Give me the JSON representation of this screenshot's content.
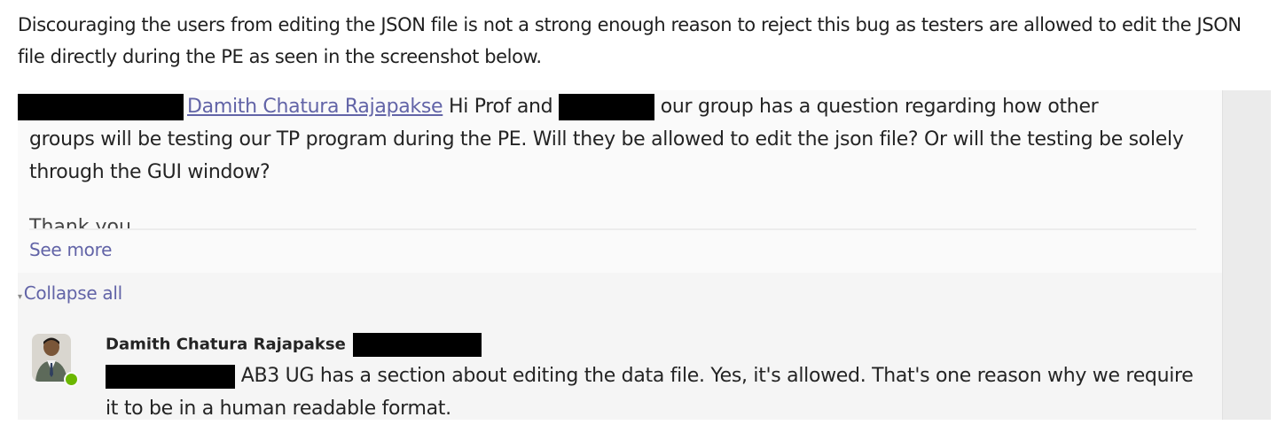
{
  "intro": {
    "text": "Discouraging the users from editing the JSON file is not a strong enough reason to reject this bug as testers are allowed to edit the JSON file directly during the PE as seen in the screenshot below."
  },
  "message": {
    "mention": "Damith Chatura Rajapakse",
    "text_after_mention": " Hi Prof and ",
    "text_after_redaction": " our group has a question regarding how other",
    "text_rest": "groups will be testing our TP program during the PE. Will they be allowed to edit the json file? Or will the testing be solely through the GUI window?",
    "faded_line": "Thank you",
    "see_more": "See more"
  },
  "thread": {
    "collapse_all": "Collapse all"
  },
  "reply": {
    "author": "Damith Chatura Rajapakse",
    "text": " AB3 UG has a section about editing the data file. Yes, it's allowed. That's one reason why we require it to be in a human readable format.",
    "presence_color": "#6bb700"
  },
  "colors": {
    "link": "#6264a7",
    "redaction": "#000000"
  }
}
